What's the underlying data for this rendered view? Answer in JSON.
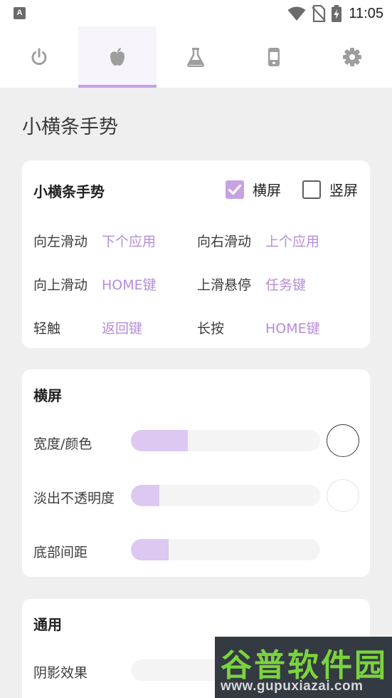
{
  "status_bar": {
    "app_icon_label": "A",
    "time": "11:05"
  },
  "tabs": [
    {
      "icon": "power-icon",
      "active": false
    },
    {
      "icon": "apple-icon",
      "active": true
    },
    {
      "icon": "flask-icon",
      "active": false
    },
    {
      "icon": "phone-icon",
      "active": false
    },
    {
      "icon": "gear-icon",
      "active": false
    }
  ],
  "page_title": "小横条手势",
  "gesture_card": {
    "title": "小横条手势",
    "landscape": {
      "label": "横屏",
      "checked": true
    },
    "portrait": {
      "label": "竖屏",
      "checked": false
    },
    "rows": [
      [
        {
          "label": "向左滑动",
          "value": "下个应用"
        },
        {
          "label": "向右滑动",
          "value": "上个应用"
        }
      ],
      [
        {
          "label": "向上滑动",
          "value": "HOME键"
        },
        {
          "label": "上滑悬停",
          "value": "任务键"
        }
      ],
      [
        {
          "label": "轻触",
          "value": "返回键"
        },
        {
          "label": "长按",
          "value": "HOME键"
        }
      ]
    ]
  },
  "landscape_card": {
    "title": "横屏",
    "sliders": [
      {
        "label": "宽度/颜色",
        "fill": 0.3,
        "swatch": "#ffffff"
      },
      {
        "label": "淡出不透明度",
        "fill": 0.15,
        "swatch": "#ffffff"
      },
      {
        "label": "底部间距",
        "fill": 0.2
      }
    ]
  },
  "general_card": {
    "title": "通用",
    "sliders": [
      {
        "label": "阴影效果"
      }
    ]
  },
  "watermark": {
    "title": "谷普软件园",
    "url": "www.gupuxiazai.com"
  },
  "colors": {
    "accent": "#c6a2e3",
    "accent_text": "#b68cd8",
    "slider_fill": "#dcc8f1",
    "background": "#efefef"
  }
}
